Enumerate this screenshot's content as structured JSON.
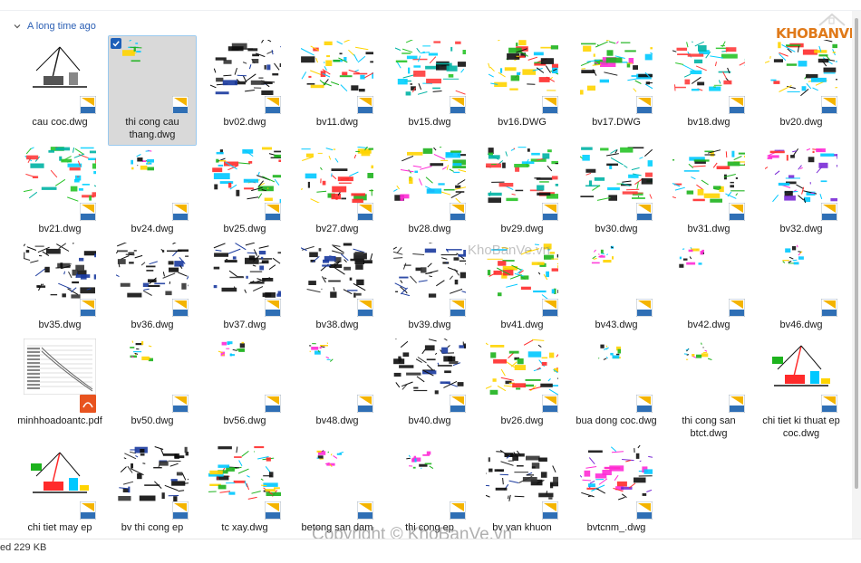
{
  "group": {
    "label": "A long time ago"
  },
  "status": {
    "text": "ed  229 KB"
  },
  "logo": {
    "text": "KHOBANVE"
  },
  "watermarks": {
    "middle": "KhoBanVe.vn",
    "bottom": "Copyright © KhoBanVe.vn"
  },
  "colors": {
    "accent": "#2b5fb4",
    "selection": "#d9d9d9",
    "dwg_badge": "#2f6fb5"
  },
  "files": [
    {
      "name": "cau coc.dwg",
      "type": "dwg",
      "thumb": "crane"
    },
    {
      "name": "thi cong cau thang.dwg",
      "type": "dwg",
      "thumb": "sparse",
      "selected": true
    },
    {
      "name": "bv02.dwg",
      "type": "dwg",
      "thumb": "plan-dark"
    },
    {
      "name": "bv11.dwg",
      "type": "dwg",
      "thumb": "plan-color"
    },
    {
      "name": "bv15.dwg",
      "type": "dwg",
      "thumb": "plan-cyan"
    },
    {
      "name": "bv16.DWG",
      "type": "dwg",
      "thumb": "plan-color"
    },
    {
      "name": "bv17.DWG",
      "type": "dwg",
      "thumb": "plan-mixed"
    },
    {
      "name": "bv18.dwg",
      "type": "dwg",
      "thumb": "plan-cyan"
    },
    {
      "name": "bv20.dwg",
      "type": "dwg",
      "thumb": "plan-yellow"
    },
    {
      "name": "bv21.dwg",
      "type": "dwg",
      "thumb": "stair-cyan"
    },
    {
      "name": "bv24.dwg",
      "type": "dwg",
      "thumb": "small"
    },
    {
      "name": "bv25.dwg",
      "type": "dwg",
      "thumb": "plan-yellow"
    },
    {
      "name": "bv27.dwg",
      "type": "dwg",
      "thumb": "plan-color"
    },
    {
      "name": "bv28.dwg",
      "type": "dwg",
      "thumb": "plan-mixed"
    },
    {
      "name": "bv29.dwg",
      "type": "dwg",
      "thumb": "plan-cyan"
    },
    {
      "name": "bv30.dwg",
      "type": "dwg",
      "thumb": "plan-cyan"
    },
    {
      "name": "bv31.dwg",
      "type": "dwg",
      "thumb": "plan-yellow"
    },
    {
      "name": "bv32.dwg",
      "type": "dwg",
      "thumb": "plan-pink"
    },
    {
      "name": "bv35.dwg",
      "type": "dwg",
      "thumb": "plan-dark"
    },
    {
      "name": "bv36.dwg",
      "type": "dwg",
      "thumb": "plan-dark"
    },
    {
      "name": "bv37.dwg",
      "type": "dwg",
      "thumb": "plan-dark"
    },
    {
      "name": "bv38.dwg",
      "type": "dwg",
      "thumb": "plan-dark"
    },
    {
      "name": "bv39.dwg",
      "type": "dwg",
      "thumb": "plan-dark"
    },
    {
      "name": "bv41.dwg",
      "type": "dwg",
      "thumb": "plan-yellow"
    },
    {
      "name": "bv43.dwg",
      "type": "dwg",
      "thumb": "small"
    },
    {
      "name": "bv42.dwg",
      "type": "dwg",
      "thumb": "small"
    },
    {
      "name": "bv46.dwg",
      "type": "dwg",
      "thumb": "small"
    },
    {
      "name": "minhhoadoantc.pdf",
      "type": "pdf",
      "thumb": "pdf-chart"
    },
    {
      "name": "bv50.dwg",
      "type": "dwg",
      "thumb": "small"
    },
    {
      "name": "bv56.dwg",
      "type": "dwg",
      "thumb": "small"
    },
    {
      "name": "bv48.dwg",
      "type": "dwg",
      "thumb": "small"
    },
    {
      "name": "bv40.dwg",
      "type": "dwg",
      "thumb": "plan-dark"
    },
    {
      "name": "bv26.dwg",
      "type": "dwg",
      "thumb": "plan-yellow"
    },
    {
      "name": "bua dong coc.dwg",
      "type": "dwg",
      "thumb": "small"
    },
    {
      "name": "thi cong san btct.dwg",
      "type": "dwg",
      "thumb": "small"
    },
    {
      "name": "chi tiet ki thuat ep coc.dwg",
      "type": "dwg",
      "thumb": "crane-color"
    },
    {
      "name": "chi tiet may ep",
      "type": "dwg",
      "thumb": "crane-color"
    },
    {
      "name": "bv thi cong ep",
      "type": "dwg",
      "thumb": "plan-dark"
    },
    {
      "name": "tc xay.dwg",
      "type": "dwg",
      "thumb": "plan-yellow"
    },
    {
      "name": "betong san dam",
      "type": "dwg",
      "thumb": "small"
    },
    {
      "name": "thi cong ep",
      "type": "dwg",
      "thumb": "small"
    },
    {
      "name": "bv van khuon",
      "type": "dwg",
      "thumb": "plan-dark"
    },
    {
      "name": "bvtcnm_.dwg",
      "type": "dwg",
      "thumb": "plan-pink"
    }
  ]
}
